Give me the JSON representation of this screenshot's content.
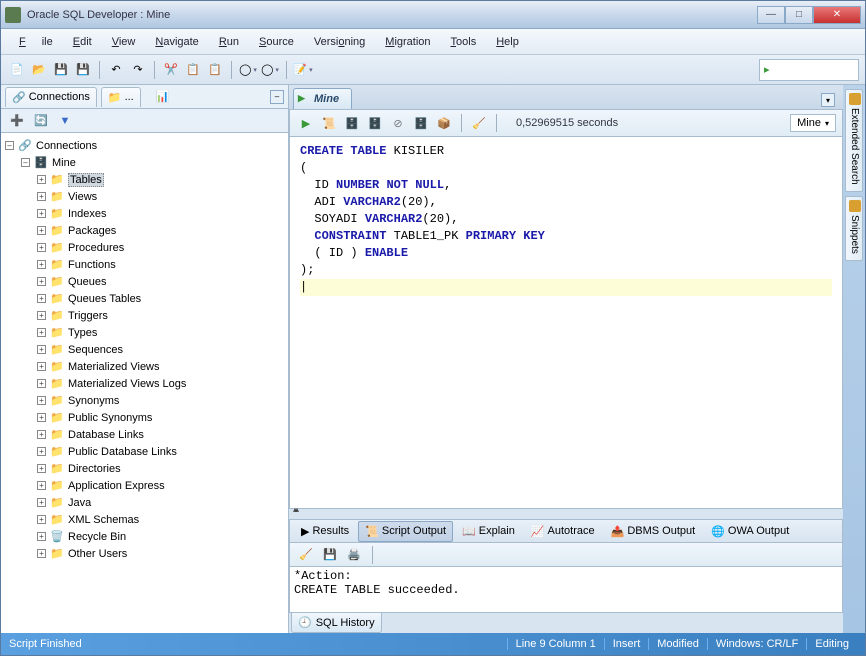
{
  "window": {
    "title": "Oracle SQL Developer : Mine"
  },
  "menu": {
    "file": "File",
    "edit": "Edit",
    "view": "View",
    "navigate": "Navigate",
    "run": "Run",
    "source": "Source",
    "versioning": "Versioning",
    "migration": "Migration",
    "tools": "Tools",
    "help": "Help"
  },
  "side": {
    "tab_connections": "Connections",
    "tab_reports": "...",
    "root": "Connections",
    "conn": "Mine",
    "items": [
      "Tables",
      "Views",
      "Indexes",
      "Packages",
      "Procedures",
      "Functions",
      "Queues",
      "Queues Tables",
      "Triggers",
      "Types",
      "Sequences",
      "Materialized Views",
      "Materialized Views Logs",
      "Synonyms",
      "Public Synonyms",
      "Database Links",
      "Public Database Links",
      "Directories",
      "Application Express",
      "Java",
      "XML Schemas",
      "Recycle Bin",
      "Other Users"
    ]
  },
  "ws": {
    "tab": "Mine",
    "elapsed": "0,52969515 seconds",
    "conn": "Mine",
    "sql_lines": [
      {
        "indent": 0,
        "tokens": [
          {
            "t": "CREATE",
            "kw": true
          },
          {
            "t": " "
          },
          {
            "t": "TABLE",
            "kw": true
          },
          {
            "t": " KISILER"
          }
        ]
      },
      {
        "indent": 0,
        "tokens": [
          {
            "t": "("
          }
        ]
      },
      {
        "indent": 1,
        "tokens": [
          {
            "t": "ID "
          },
          {
            "t": "NUMBER",
            "kw": true
          },
          {
            "t": " "
          },
          {
            "t": "NOT",
            "kw": true
          },
          {
            "t": " "
          },
          {
            "t": "NULL",
            "kw": true
          },
          {
            "t": ","
          }
        ]
      },
      {
        "indent": 1,
        "tokens": [
          {
            "t": "ADI "
          },
          {
            "t": "VARCHAR2",
            "kw": true
          },
          {
            "t": "(20),"
          }
        ]
      },
      {
        "indent": 1,
        "tokens": [
          {
            "t": "SOYADI "
          },
          {
            "t": "VARCHAR2",
            "kw": true
          },
          {
            "t": "(20),"
          }
        ]
      },
      {
        "indent": 1,
        "tokens": [
          {
            "t": "CONSTRAINT",
            "kw": true
          },
          {
            "t": " TABLE1_PK "
          },
          {
            "t": "PRIMARY",
            "kw": true
          },
          {
            "t": " "
          },
          {
            "t": "KEY",
            "kw": true
          }
        ]
      },
      {
        "indent": 1,
        "tokens": [
          {
            "t": "( ID ) "
          },
          {
            "t": "ENABLE",
            "kw": true
          }
        ]
      },
      {
        "indent": 0,
        "tokens": [
          {
            "t": ");"
          }
        ]
      }
    ]
  },
  "out": {
    "tabs": [
      "Results",
      "Script Output",
      "Explain",
      "Autotrace",
      "DBMS Output",
      "OWA Output"
    ],
    "active": "Script Output",
    "lines": [
      "*Action:",
      "CREATE TABLE succeeded.",
      ""
    ],
    "history": "SQL History"
  },
  "status": {
    "left": "Script Finished",
    "line_col": "Line 9 Column 1",
    "insert": "Insert",
    "modified": "Modified",
    "encoding": "Windows: CR/LF",
    "mode": "Editing"
  },
  "right_panels": [
    "Extended Search",
    "Snippets"
  ]
}
